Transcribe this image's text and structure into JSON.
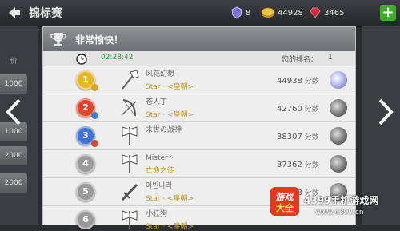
{
  "header": {
    "title": "锦标赛"
  },
  "resources": [
    {
      "icon": "shield-gem-icon",
      "value": "8"
    },
    {
      "icon": "gold-coin-icon",
      "value": "44928"
    },
    {
      "icon": "ruby-icon",
      "value": "3465"
    }
  ],
  "plus_label": "+",
  "side": {
    "label": "价",
    "buttons": [
      "1000",
      "1000",
      "2000",
      "2000"
    ]
  },
  "panel": {
    "title": "非常愉快！",
    "timer": "02:28:42",
    "my_rank_label": "您的排名：",
    "my_rank_value": "1"
  },
  "rows": [
    {
      "rank": "1",
      "name": "风花幻想",
      "guild": "Star · <皇朝>",
      "score": "44938",
      "unit": "分数",
      "medal": "gold"
    },
    {
      "rank": "2",
      "name": "苍人丁",
      "guild": "Star · <皇朝>",
      "score": "42760",
      "unit": "分数",
      "medal": "red"
    },
    {
      "rank": "3",
      "name": "末世の战神",
      "guild": "",
      "score": "38307",
      "unit": "分数",
      "medal": "blue"
    },
    {
      "rank": "4",
      "name": "Mister丶",
      "guild": "亡命之徒",
      "score": "37362",
      "unit": "分数",
      "medal": "gray"
    },
    {
      "rank": "5",
      "name": "아빈나라",
      "guild": "Star · <皇朝>",
      "score": "37268",
      "unit": "分数",
      "medal": "gray"
    },
    {
      "rank": "6",
      "name": "小狂狗",
      "guild": "Star · <皇朝>",
      "score": "",
      "unit": "",
      "medal": "gray"
    }
  ],
  "watermark": {
    "logo_top": "游戏",
    "logo_bottom": "大全",
    "site": "4399手机游戏网",
    "url": "www.4399.cn"
  }
}
